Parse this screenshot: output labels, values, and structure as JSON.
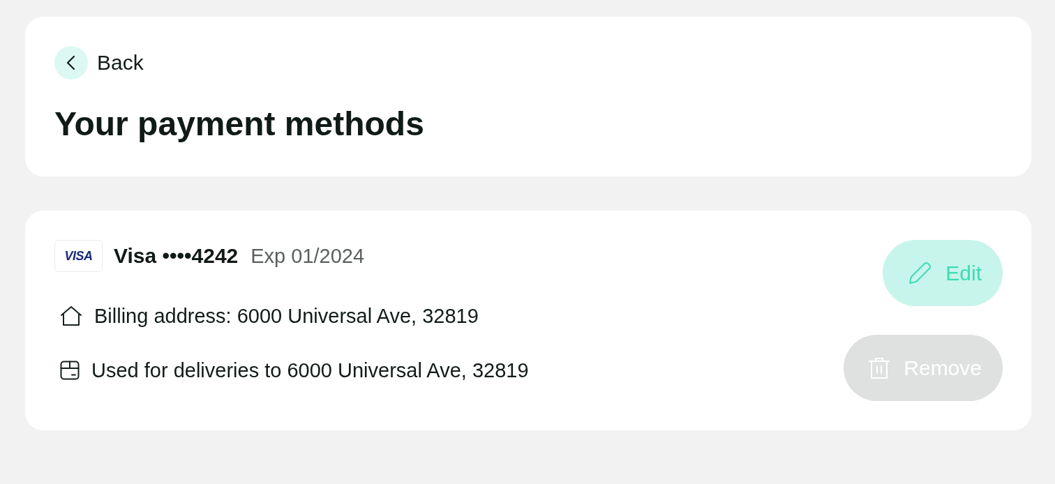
{
  "back": {
    "label": "Back"
  },
  "title": "Your payment methods",
  "methods": [
    {
      "brand": "VISA",
      "name": "Visa ••••4242",
      "expiry": "Exp 01/2024",
      "details": [
        {
          "kind": "billing",
          "text": "Billing address: 6000 Universal Ave, 32819"
        },
        {
          "kind": "delivery",
          "text": "Used for deliveries to 6000 Universal Ave, 32819"
        }
      ],
      "actions": [
        {
          "kind": "edit",
          "label": "Edit",
          "disabled": false
        },
        {
          "kind": "remove",
          "label": "Remove",
          "disabled": true
        }
      ]
    }
  ]
}
